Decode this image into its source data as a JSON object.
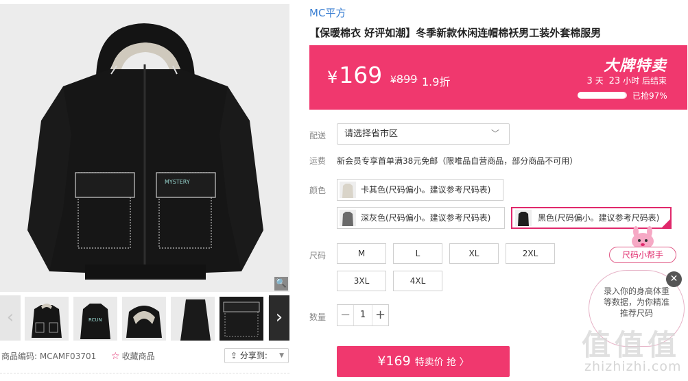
{
  "gallery": {
    "main_image_alt": "black hooded padded jacket",
    "thumbnails": [
      "jacket-front-thumb",
      "jacket-back-thumb",
      "hood-closeup-thumb",
      "sleeve-closeup-thumb",
      "pocket-closeup-thumb",
      "detail-thumb"
    ],
    "sku_label": "商品编码: MCAMF03701",
    "favorite_label": "收藏商品",
    "share_label": "分享到:",
    "back_print": "RCUN",
    "chest_print": "MYSTERY"
  },
  "product": {
    "brand": "MC平方",
    "title": "【保暖棉衣 好评如潮】冬季新款休闲连帽棉袄男工装外套棉服男"
  },
  "price": {
    "yen": "¥",
    "current": "169",
    "original": "899",
    "discount": "1.9折",
    "promo_title": "大牌特卖",
    "countdown_days": "3",
    "countdown_day_unit": "天",
    "countdown_hours": "23",
    "countdown_hour_unit": "小时",
    "countdown_suffix": "后结束",
    "sold_percent": 97,
    "sold_text": "已抢97%",
    "color": "#f0386e"
  },
  "delivery": {
    "label": "配送",
    "select_value": "请选择省市区"
  },
  "shipping": {
    "label": "运费",
    "text": "新会员专享首单满38元免邮（限唯品自营商品，部分商品不可用）"
  },
  "colors": {
    "label": "颜色",
    "options": [
      {
        "label": "卡其色(尺码偏小。建议参考尺码表)",
        "swatch": "#d9d4c9"
      },
      {
        "label": "深灰色(尺码偏小。建议参考尺码表)",
        "swatch": "#6a6a6a"
      },
      {
        "label": "黑色(尺码偏小。建议参考尺码表)",
        "swatch": "#1e1e1e"
      }
    ],
    "selected_index": 2
  },
  "sizes": {
    "label": "尺码",
    "options": [
      "M",
      "L",
      "XL",
      "2XL",
      "3XL",
      "4XL"
    ]
  },
  "quantity": {
    "label": "数量",
    "value": "1",
    "minus": "−",
    "plus": "+"
  },
  "buy_button": {
    "price": "¥169",
    "label": "特卖价 抢 〉"
  },
  "helper": {
    "tag": "尺码小帮手",
    "bubble_text": "录入你的身高体重等数据，为你精准推荐尺码",
    "close": "✕"
  },
  "watermark": {
    "glyphs": [
      "值",
      "值",
      "值"
    ],
    "text": "zhizhizhi.com"
  }
}
